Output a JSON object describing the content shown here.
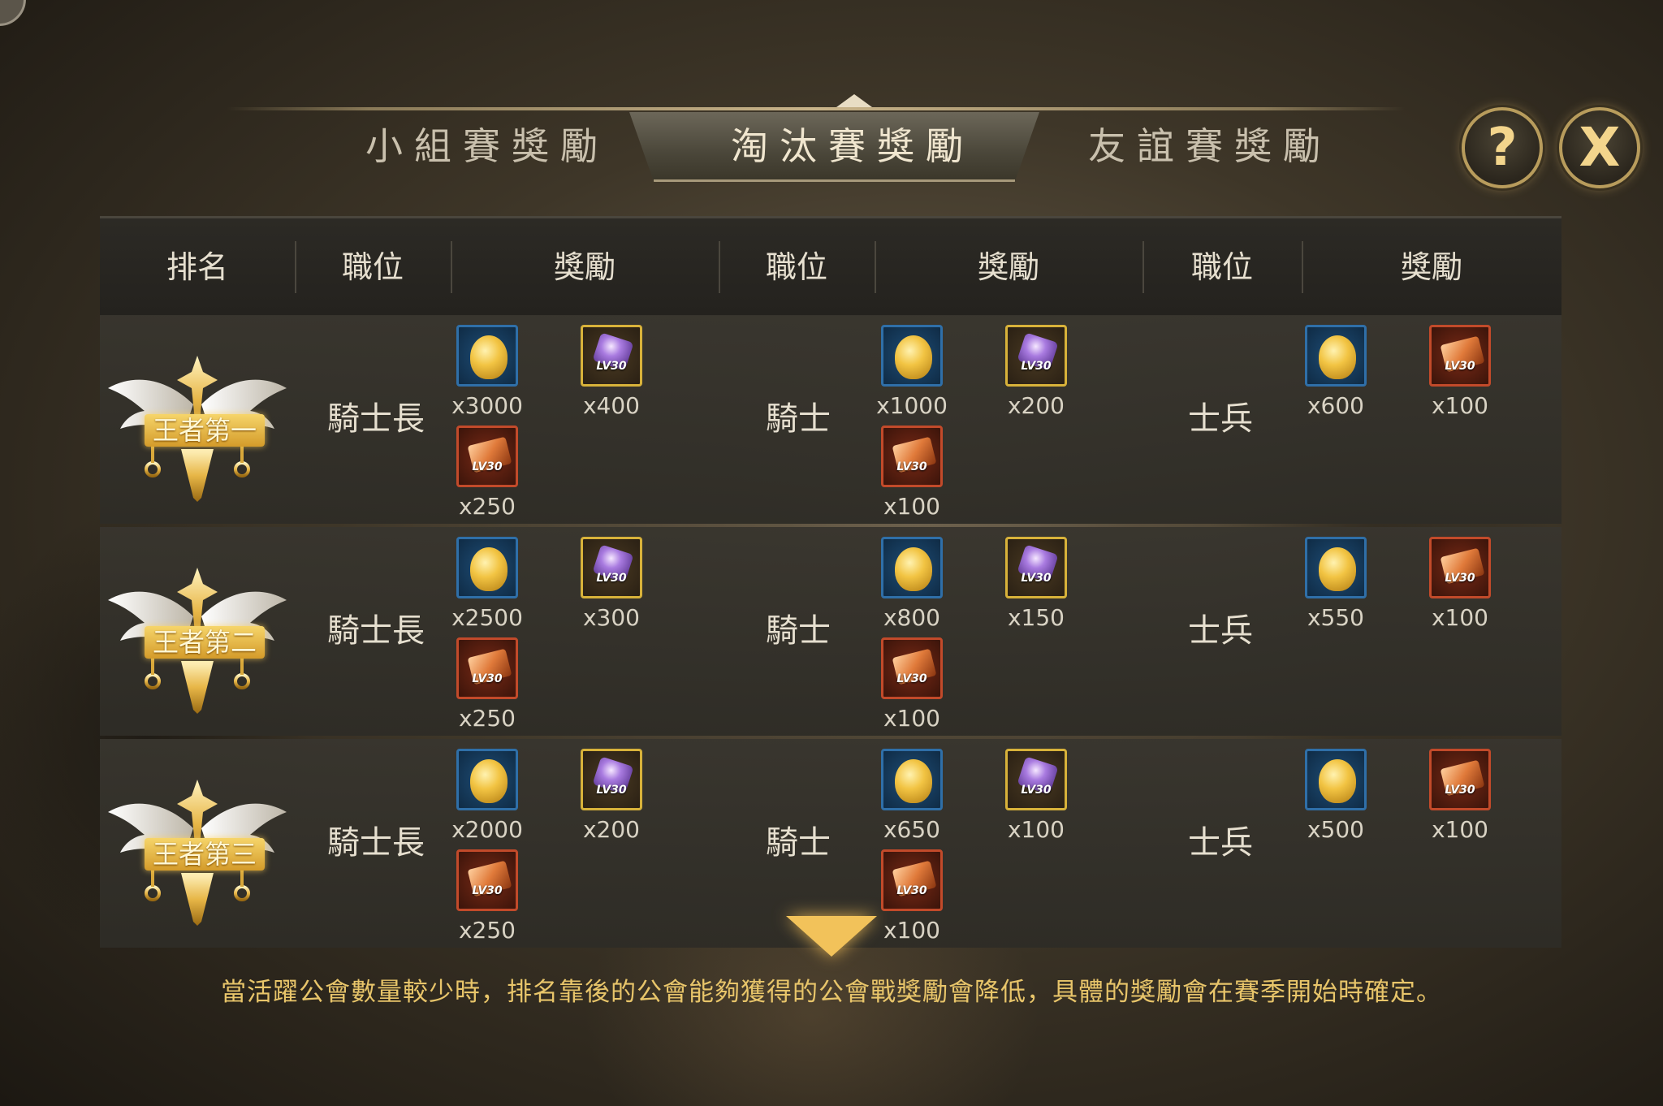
{
  "tabs": [
    {
      "label": "小組賽獎勵",
      "active": false
    },
    {
      "label": "淘汰賽獎勵",
      "active": true
    },
    {
      "label": "友誼賽獎勵",
      "active": false
    }
  ],
  "buttons": {
    "help": "?",
    "close": "X"
  },
  "headers": {
    "rank": "排名",
    "position1": "職位",
    "reward1": "獎勵",
    "position2": "職位",
    "reward2": "獎勵",
    "position3": "職位",
    "reward3": "獎勵"
  },
  "rows": [
    {
      "rank": "王者第一",
      "role1": "騎士長",
      "role2": "騎士",
      "role3": "士兵",
      "g1": {
        "gold": "x3000",
        "gem": "x400",
        "scroll": "x250"
      },
      "g2": {
        "gold": "x1000",
        "gem": "x200",
        "scroll": "x100"
      },
      "g3": {
        "gold": "x600",
        "scroll": "x100"
      }
    },
    {
      "rank": "王者第二",
      "role1": "騎士長",
      "role2": "騎士",
      "role3": "士兵",
      "g1": {
        "gold": "x2500",
        "gem": "x300",
        "scroll": "x250"
      },
      "g2": {
        "gold": "x800",
        "gem": "x150",
        "scroll": "x100"
      },
      "g3": {
        "gold": "x550",
        "scroll": "x100"
      }
    },
    {
      "rank": "王者第三",
      "role1": "騎士長",
      "role2": "騎士",
      "role3": "士兵",
      "g1": {
        "gold": "x2000",
        "gem": "x200",
        "scroll": "x250"
      },
      "g2": {
        "gold": "x650",
        "gem": "x100",
        "scroll": "x100"
      },
      "g3": {
        "gold": "x500",
        "scroll": "x100"
      }
    }
  ],
  "item_level_label": "LV30",
  "icons": {
    "gold": "gold-coin-icon",
    "gem": "purple-gem-icon",
    "scroll": "orange-scroll-icon"
  },
  "footnote": "當活躍公會數量較少時，排名靠後的公會能夠獲得的公會戰獎勵會降低，具體的獎勵會在賽季開始時確定。"
}
